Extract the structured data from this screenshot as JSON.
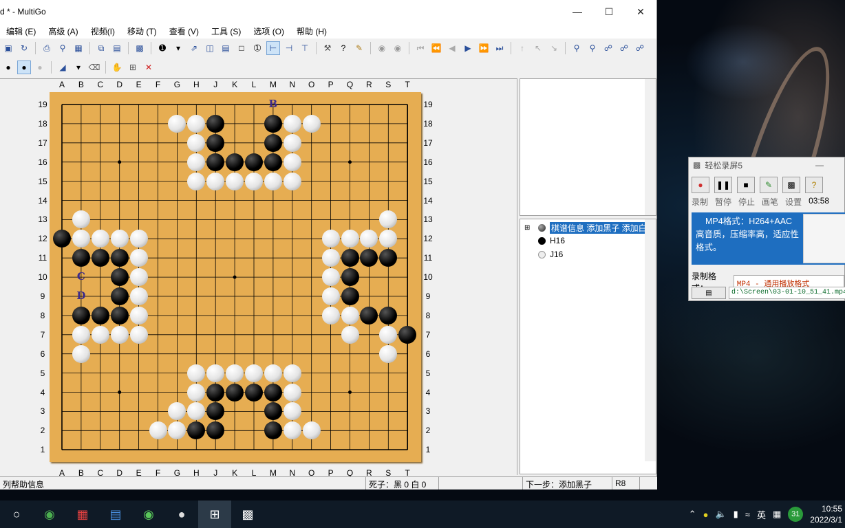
{
  "window": {
    "title": "d  * - MultiGo",
    "menu": [
      "编辑 (E)",
      "高级 (A)",
      "视频(I)",
      "移动 (T)",
      "查看 (V)",
      "工具 (S)",
      "选项 (O)",
      "帮助 (H)"
    ]
  },
  "board": {
    "cols": [
      "A",
      "B",
      "C",
      "D",
      "E",
      "F",
      "G",
      "H",
      "J",
      "K",
      "L",
      "M",
      "N",
      "O",
      "P",
      "Q",
      "R",
      "S",
      "T"
    ],
    "rows": [
      "19",
      "18",
      "17",
      "16",
      "15",
      "14",
      "13",
      "12",
      "11",
      "10",
      "9",
      "8",
      "7",
      "6",
      "5",
      "4",
      "3",
      "2",
      "1"
    ],
    "black": [
      "J18",
      "M18",
      "J17",
      "M17",
      "J16",
      "K16",
      "L16",
      "M16",
      "A12",
      "B11",
      "C11",
      "D11",
      "D10",
      "D9",
      "B8",
      "C8",
      "D8",
      "Q11",
      "R11",
      "S11",
      "Q10",
      "Q9",
      "R8",
      "S8",
      "T7",
      "J4",
      "K4",
      "L4",
      "M4",
      "J3",
      "M3",
      "H2",
      "J2",
      "M2"
    ],
    "white": [
      "G18",
      "H18",
      "N18",
      "O18",
      "H17",
      "N17",
      "H16",
      "N16",
      "H15",
      "J15",
      "K15",
      "L15",
      "M15",
      "N15",
      "B13",
      "B12",
      "C12",
      "D12",
      "E12",
      "E11",
      "E10",
      "E9",
      "E8",
      "B7",
      "C7",
      "D7",
      "E7",
      "B6",
      "S13",
      "P12",
      "Q12",
      "R12",
      "S12",
      "P11",
      "P10",
      "P9",
      "P8",
      "Q8",
      "Q7",
      "S7",
      "S6",
      "H5",
      "J5",
      "K5",
      "L5",
      "M5",
      "N5",
      "H4",
      "N4",
      "G3",
      "H3",
      "N3",
      "F2",
      "G2",
      "N2",
      "O2"
    ],
    "labels": [
      {
        "text": "B",
        "pos": "M19"
      },
      {
        "text": "C",
        "pos": "B10"
      },
      {
        "text": "D",
        "pos": "B9"
      }
    ]
  },
  "tree": {
    "root_label": "棋谱信息 添加黑子 添加白",
    "items": [
      {
        "label": "H16",
        "color": "black"
      },
      {
        "label": "J16",
        "color": "white"
      }
    ]
  },
  "status": {
    "help": "列帮助信息",
    "dead": "死子：黑 0 白 0",
    "next": "下一步：添加黑子",
    "coord": "R8"
  },
  "recorder": {
    "title": "轻松录屏5",
    "labels": [
      "录制",
      "暂停",
      "停止",
      "画笔",
      "设置"
    ],
    "timer": "03:58",
    "info_line1": "MP4格式：H264+AAC",
    "info_line2": "高音质，压缩率高，适应性",
    "info_line3": "格式。",
    "format_label": "录制格式：",
    "format_value": "MP4 - 通用播放格式",
    "path": "d:\\Screen\\03-01-10_51_41.mp4"
  },
  "taskbar": {
    "ime": "英",
    "badge": "31",
    "time": "10:55",
    "date": "2022/3/1"
  }
}
